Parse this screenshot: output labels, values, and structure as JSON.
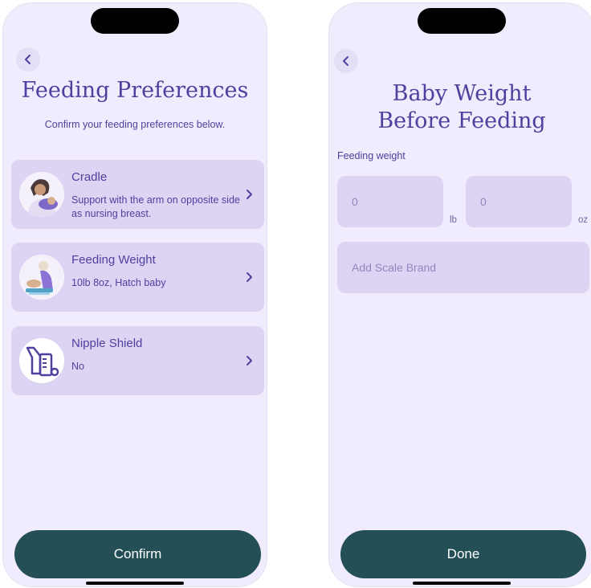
{
  "left_screen": {
    "title": "Feeding Preferences",
    "subtitle": "Confirm your feeding preferences below.",
    "cards": [
      {
        "title": "Cradle",
        "description": "Support with the arm on opposite side as nursing breast.",
        "icon": "cradle-hold-illustration"
      },
      {
        "title": "Feeding Weight",
        "description": "10lb 8oz, Hatch baby",
        "icon": "baby-on-scale-illustration"
      },
      {
        "title": "Nipple Shield",
        "description": "No",
        "icon": "breast-pump-icon"
      }
    ],
    "confirm_label": "Confirm"
  },
  "right_screen": {
    "title": "Baby Weight Before Feeding",
    "feeding_weight_label": "Feeding weight",
    "lb_value": "0",
    "lb_unit": "lb",
    "oz_value": "0",
    "oz_unit": "oz",
    "scale_brand_placeholder": "Add Scale Brand",
    "done_label": "Done"
  },
  "colors": {
    "background": "#f0ecfd",
    "card": "#ddd4f3",
    "accent_text": "#4f3f9e",
    "primary_button": "#244f56"
  }
}
